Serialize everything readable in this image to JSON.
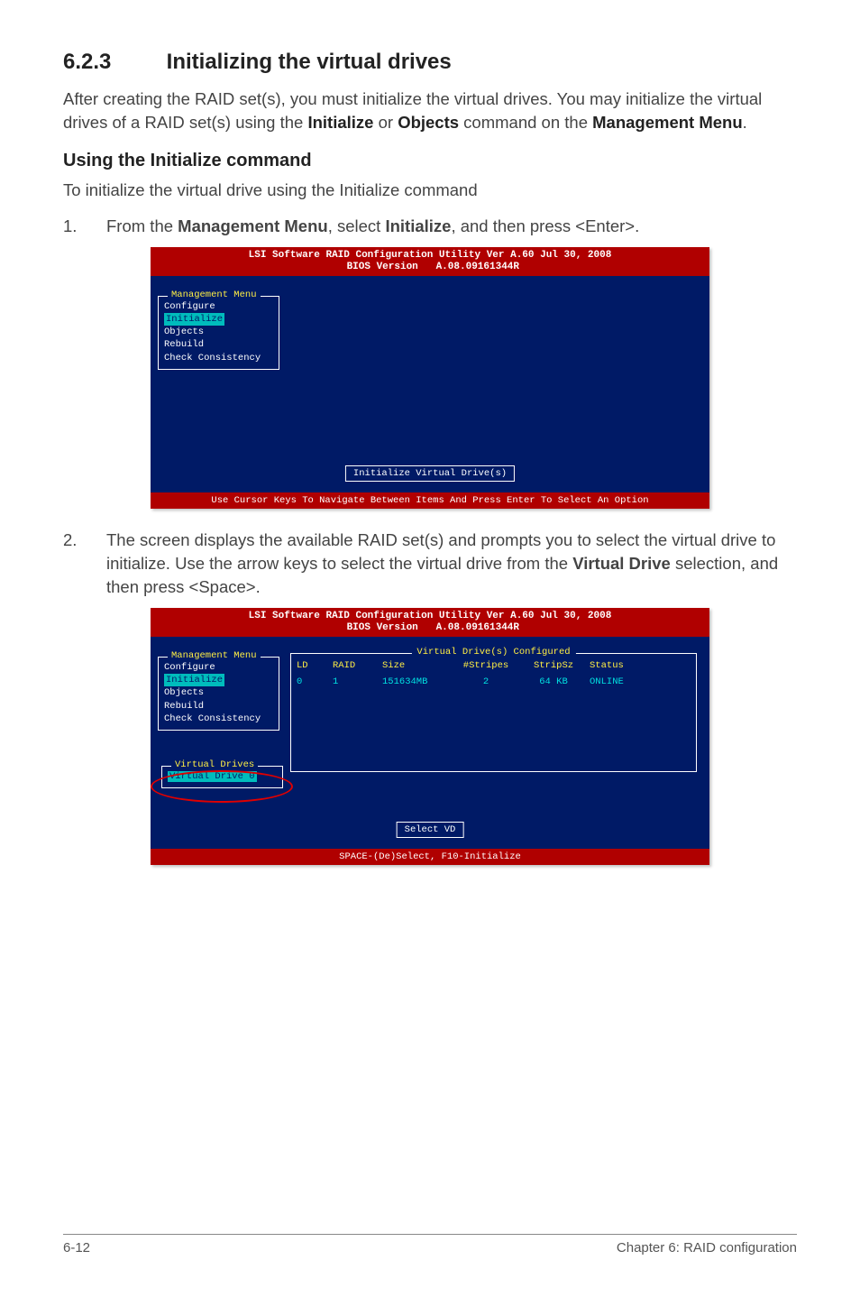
{
  "section": {
    "number": "6.2.3",
    "title": "Initializing the virtual drives"
  },
  "intro": {
    "p1_a": "After creating the RAID set(s), you must initialize the virtual drives. You may initialize the virtual drives of a RAID set(s) using the ",
    "p1_b": "Initialize",
    "p1_c": " or ",
    "p1_d": "Objects",
    "p1_e": " command on the ",
    "p1_f": "Management Menu",
    "p1_g": "."
  },
  "subhead": "Using the Initialize command",
  "subintro": "To initialize the virtual drive using the Initialize command",
  "steps": {
    "s1": {
      "num": "1.",
      "a": "From the ",
      "b": "Management Menu",
      "c": ", select ",
      "d": "Initialize",
      "e": ", and then press <Enter>."
    },
    "s2": {
      "num": "2.",
      "a": "The screen displays the available RAID set(s) and prompts you to select the virtual drive to initialize. Use the arrow keys to select the virtual drive from the ",
      "b": "Virtual Drive",
      "c": " selection, and then press <Space>."
    }
  },
  "bios1": {
    "header": "LSI Software RAID Configuration Utility Ver A.60 Jul 30, 2008\n BIOS Version   A.08.09161344R",
    "menu_title": "Management Menu",
    "menu_items": [
      "Configure",
      "Initialize",
      "Objects",
      "Rebuild",
      "Check Consistency"
    ],
    "selected_idx": 1,
    "hint": "Initialize Virtual Drive(s)",
    "footer": "Use Cursor Keys To Navigate Between Items And Press Enter To Select An Option"
  },
  "bios2": {
    "header": "LSI Software RAID Configuration Utility Ver A.60 Jul 30, 2008\n BIOS Version   A.08.09161344R",
    "menu_title": "Management Menu",
    "menu_items": [
      "Configure",
      "Initialize",
      "Objects",
      "Rebuild",
      "Check Consistency"
    ],
    "selected_idx": 1,
    "table_title": "Virtual Drive(s) Configured",
    "cols": {
      "ld": "LD",
      "raid": "RAID",
      "size": "Size",
      "stripes": "#Stripes",
      "stripsz": "StripSz",
      "status": "Status"
    },
    "row": {
      "ld": "0",
      "raid": "1",
      "size": "151634MB",
      "stripes": "2",
      "stripsz": "64 KB",
      "status": "ONLINE"
    },
    "drives_title": "Virtual Drives",
    "drive_item": "Virtual Drive 0",
    "hint": "Select VD",
    "footer": "SPACE-(De)Select,  F10-Initialize"
  },
  "footer": {
    "left": "6-12",
    "right": "Chapter 6: RAID configuration"
  }
}
